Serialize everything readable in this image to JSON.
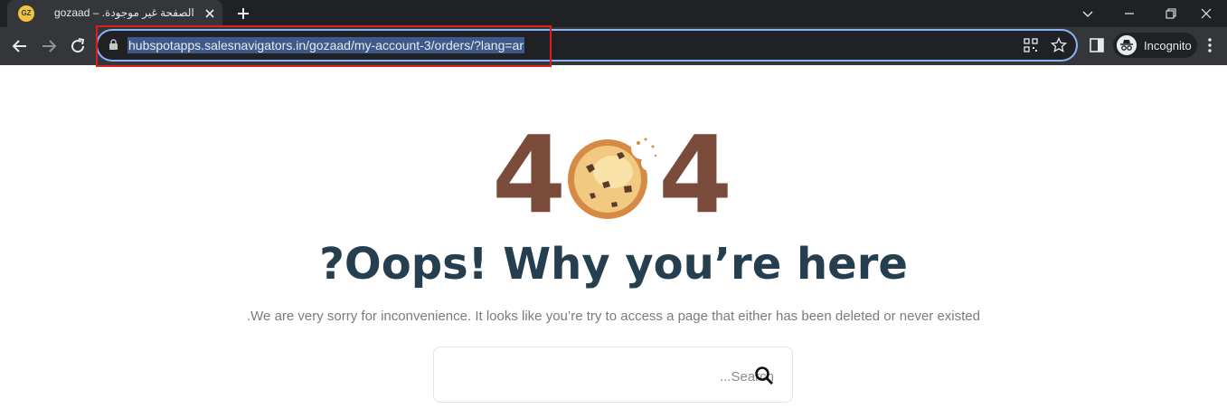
{
  "browser": {
    "tab": {
      "favicon_text": "GZ",
      "title": "الصفحة غير موجودة. – gozaad"
    },
    "address_bar": {
      "url": "hubspotapps.salesnavigators.in/gozaad/my-account-3/orders/?lang=ar"
    },
    "profile": {
      "label": "Incognito"
    }
  },
  "page": {
    "error_code": {
      "digit_left": "4",
      "digit_right": "4"
    },
    "heading": "Oops! Why you’re here?",
    "message": "We are very sorry for inconvenience. It looks like you’re try to access a page that either has been deleted or never existed.",
    "search": {
      "placeholder": "Search..."
    }
  },
  "colors": {
    "accent_digits": "#7a4a3a",
    "heading": "#253f50",
    "annotation_box": "#e01c1c",
    "omnibox_focus": "#8ab4f8"
  }
}
